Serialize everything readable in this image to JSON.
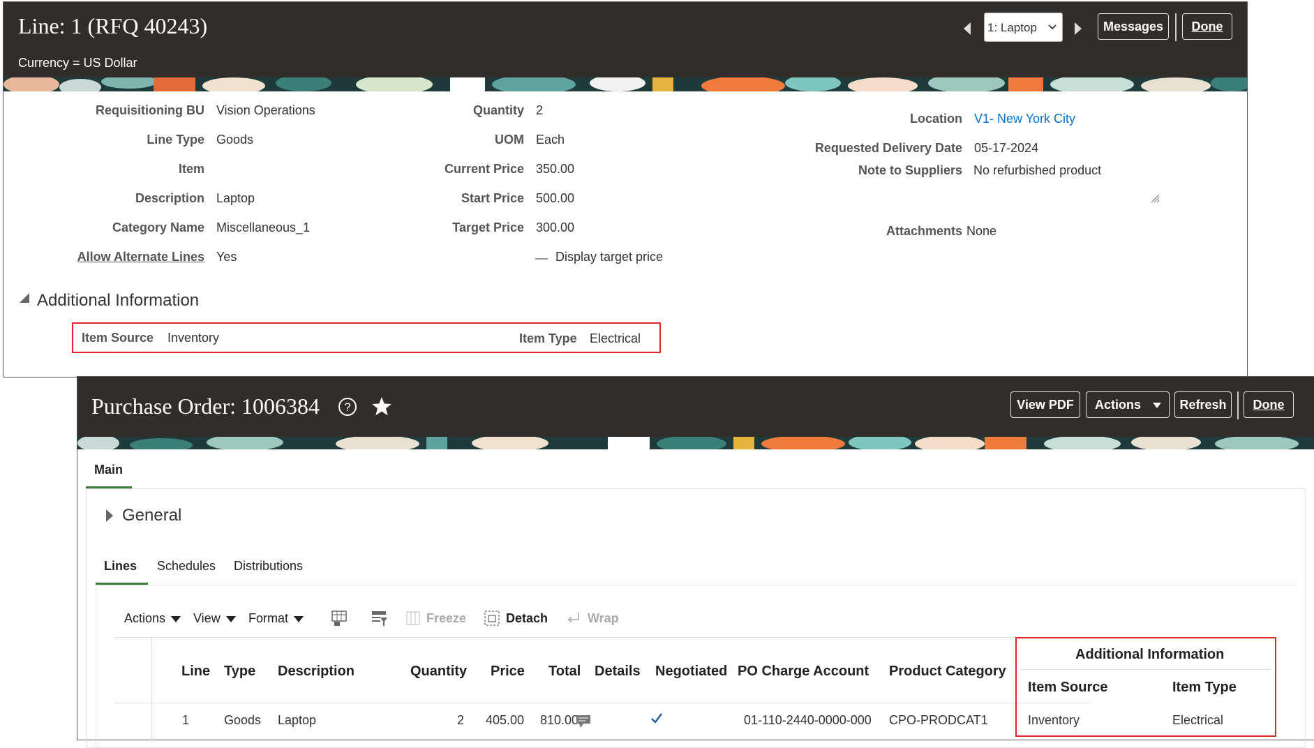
{
  "line_panel": {
    "title": "Line: 1 (RFQ 40243)",
    "currency": "Currency = US Dollar",
    "line_selector": "1: Laptop",
    "messages_button": "Messages",
    "done_button": "Done",
    "left_fields": [
      {
        "label": "Requisitioning BU",
        "value": "Vision Operations"
      },
      {
        "label": "Line Type",
        "value": "Goods"
      },
      {
        "label": "Item",
        "value": ""
      },
      {
        "label": "Description",
        "value": "Laptop"
      },
      {
        "label": "Category Name",
        "value": "Miscellaneous_1"
      },
      {
        "label": "Allow Alternate Lines",
        "value": "Yes"
      }
    ],
    "mid_fields": [
      {
        "label": "Quantity",
        "value": "2"
      },
      {
        "label": "UOM",
        "value": "Each"
      },
      {
        "label": "Current Price",
        "value": "350.00"
      },
      {
        "label": "Start Price",
        "value": "500.00"
      },
      {
        "label": "Target Price",
        "value": "300.00"
      }
    ],
    "display_target_price": "Display target price",
    "right_fields": {
      "location_label": "Location",
      "location_value": "V1- New York City",
      "delivery_label": "Requested Delivery Date",
      "delivery_value": "05-17-2024",
      "note_label": "Note to Suppliers",
      "note_value": "No refurbished product",
      "attachments_label": "Attachments",
      "attachments_value": "None"
    },
    "additional_info": {
      "heading": "Additional Information",
      "item_source_label": "Item Source",
      "item_source_value": "Inventory",
      "item_type_label": "Item Type",
      "item_type_value": "Electrical"
    }
  },
  "po_panel": {
    "title": "Purchase Order: 1006384",
    "view_pdf": "View PDF",
    "actions": "Actions",
    "refresh": "Refresh",
    "done": "Done",
    "main_tab": "Main",
    "general": "General",
    "subtabs": [
      "Lines",
      "Schedules",
      "Distributions"
    ],
    "toolbar": {
      "actions": "Actions",
      "view": "View",
      "format": "Format",
      "freeze": "Freeze",
      "detach": "Detach",
      "wrap": "Wrap"
    },
    "table": {
      "additional_info_group": "Additional Information",
      "headers": [
        "Line",
        "Type",
        "Description",
        "Quantity",
        "Price",
        "Total",
        "Details",
        "Negotiated",
        "PO Charge Account",
        "Product Category",
        "Item Source",
        "Item Type"
      ],
      "row": [
        "1",
        "Goods",
        "Laptop",
        "2",
        "405.00",
        "810.00",
        "",
        "",
        "01-110-2440-0000-000",
        "CPO-PRODCAT1",
        "Inventory",
        "Electrical"
      ]
    }
  },
  "colors": {
    "header_bg": "#312d2a",
    "highlight_red": "#e0262b",
    "link": "#0572ce",
    "tab_underline": "#3a7a3a"
  }
}
